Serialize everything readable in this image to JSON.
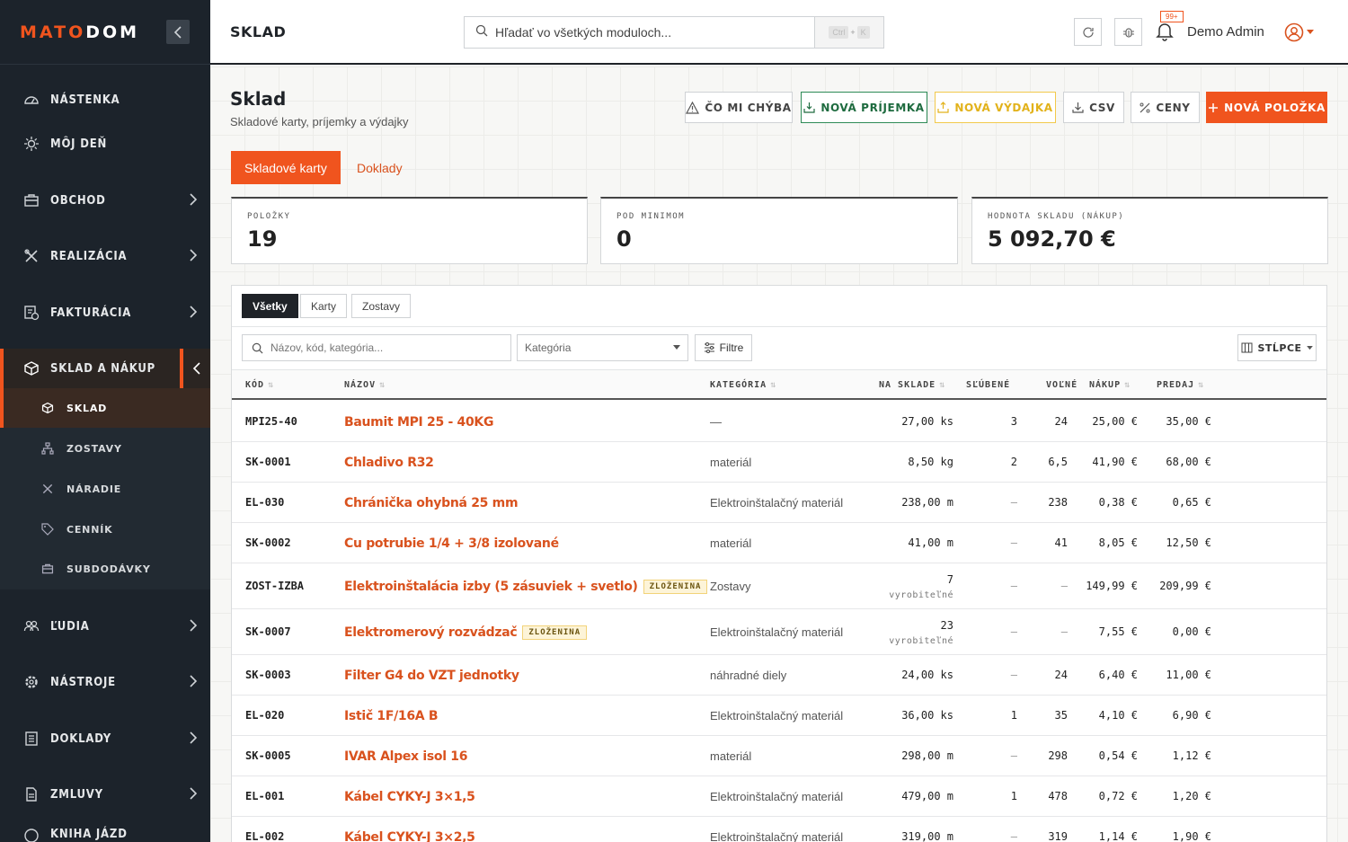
{
  "sidebar": {
    "logo_prefix": "MATO",
    "logo_suffix": "DOM",
    "items": [
      {
        "label": "NÁSTENKA",
        "icon": "dashboard-icon"
      },
      {
        "label": "MÔJ DEŇ",
        "icon": "sun-icon"
      },
      {
        "label": "OBCHOD",
        "icon": "briefcase-icon"
      },
      {
        "label": "REALIZÁCIA",
        "icon": "tools-icon"
      },
      {
        "label": "FAKTURÁCIA",
        "icon": "invoice-icon"
      },
      {
        "label": "SKLAD A NÁKUP",
        "icon": "box-icon"
      },
      {
        "label": "ĽUDIA",
        "icon": "users-icon"
      },
      {
        "label": "NÁSTROJE",
        "icon": "gear-icon"
      },
      {
        "label": "DOKLADY",
        "icon": "document-icon"
      },
      {
        "label": "ZMLUVY",
        "icon": "contract-icon"
      },
      {
        "label": "KNIHA JÁZD",
        "icon": "car-icon"
      }
    ],
    "subitems": [
      {
        "label": "SKLAD",
        "icon": "box-icon"
      },
      {
        "label": "ZOSTAVY",
        "icon": "sitemap-icon"
      },
      {
        "label": "NÁRADIE",
        "icon": "tools-icon"
      },
      {
        "label": "CENNÍK",
        "icon": "tag-icon"
      },
      {
        "label": "SUBDODÁVKY",
        "icon": "briefcase-icon"
      }
    ]
  },
  "header": {
    "title": "SKLAD",
    "search_placeholder": "Hľadať vo všetkých moduloch...",
    "kbd_ctrl": "Ctrl",
    "kbd_plus": "+",
    "kbd_key": "K",
    "notif_count": "99+",
    "user_name": "Demo Admin"
  },
  "page": {
    "title": "Sklad",
    "subtitle": "Skladové karty, príjemky a výdajky",
    "actions": {
      "missing": "ČO MI CHÝBA",
      "receipt": "NOVÁ PRÍJEMKA",
      "issue": "NOVÁ VÝDAJKA",
      "csv": "CSV",
      "prices": "CENY",
      "new_item": "NOVÁ POLOŽKA"
    },
    "tabs": [
      "Skladové karty",
      "Doklady"
    ]
  },
  "stats": [
    {
      "label": "POLOŽKY",
      "value": "19"
    },
    {
      "label": "POD MINIMOM",
      "value": "0"
    },
    {
      "label": "HODNOTA SKLADU (NÁKUP)",
      "value": "5 092,70 €"
    }
  ],
  "filters": {
    "segments": [
      "Všetky",
      "Karty",
      "Zostavy"
    ],
    "search_placeholder": "Názov, kód, kategória...",
    "category_placeholder": "Kategória",
    "filter_label": "Filtre",
    "columns_label": "STĹPCE"
  },
  "table": {
    "columns": {
      "code": "KÓD",
      "name": "NÁZOV",
      "category": "KATEGÓRIA",
      "stock": "NA SKLADE",
      "promised": "SĽÚBENÉ",
      "free": "VOĽNÉ",
      "buy": "NÁKUP",
      "sell": "PREDAJ"
    },
    "badge_label": "ZLOŽENINA",
    "producible_label": "vyrobiteľné",
    "rows": [
      {
        "code": "MPI25-40",
        "name": "Baumit MPI 25 - 40KG",
        "category": "—",
        "stock": "27,00 ks",
        "promised": "3",
        "free": "24",
        "buy": "25,00 €",
        "sell": "35,00 €"
      },
      {
        "code": "SK-0001",
        "name": "Chladivo R32",
        "category": "materiál",
        "stock": "8,50 kg",
        "promised": "2",
        "free": "6,5",
        "buy": "41,90 €",
        "sell": "68,00 €"
      },
      {
        "code": "EL-030",
        "name": "Chránička ohybná 25 mm",
        "category": "Elektroinštalačný materiál",
        "stock": "238,00 m",
        "promised": "—",
        "free": "238",
        "buy": "0,38 €",
        "sell": "0,65 €"
      },
      {
        "code": "SK-0002",
        "name": "Cu potrubie 1/4 + 3/8 izolované",
        "category": "materiál",
        "stock": "41,00 m",
        "promised": "—",
        "free": "41",
        "buy": "8,05 €",
        "sell": "12,50 €"
      },
      {
        "code": "ZOST-IZBA",
        "name": "Elektroinštalácia izby (5 zásuviek + svetlo)",
        "category": "Zostavy",
        "stock": "7",
        "promised": "—",
        "free": "—",
        "buy": "149,99 €",
        "sell": "209,99 €"
      },
      {
        "code": "SK-0007",
        "name": "Elektromerový rozvádzač",
        "category": "Elektroinštalačný materiál",
        "stock": "23",
        "promised": "—",
        "free": "—",
        "buy": "7,55 €",
        "sell": "0,00 €"
      },
      {
        "code": "SK-0003",
        "name": "Filter G4 do VZT jednotky",
        "category": "náhradné diely",
        "stock": "24,00 ks",
        "promised": "—",
        "free": "24",
        "buy": "6,40 €",
        "sell": "11,00 €"
      },
      {
        "code": "EL-020",
        "name": "Istič 1F/16A B",
        "category": "Elektroinštalačný materiál",
        "stock": "36,00 ks",
        "promised": "1",
        "free": "35",
        "buy": "4,10 €",
        "sell": "6,90 €"
      },
      {
        "code": "SK-0005",
        "name": "IVAR Alpex isol 16",
        "category": "materiál",
        "stock": "298,00 m",
        "promised": "—",
        "free": "298",
        "buy": "0,54 €",
        "sell": "1,12 €"
      },
      {
        "code": "EL-001",
        "name": "Kábel CYKY-J 3×1,5",
        "category": "Elektroinštalačný materiál",
        "stock": "479,00 m",
        "promised": "1",
        "free": "478",
        "buy": "0,72 €",
        "sell": "1,20 €"
      },
      {
        "code": "EL-002",
        "name": "Kábel CYKY-J 3×2,5",
        "category": "Elektroinštalačný materiál",
        "stock": "319,00 m",
        "promised": "—",
        "free": "319",
        "buy": "1,14 €",
        "sell": "1,90 €"
      }
    ]
  },
  "colors": {
    "accent": "#f0541e",
    "sidebar_bg": "#1c232b",
    "success": "#2e8b57",
    "warning": "#f2c94c"
  }
}
